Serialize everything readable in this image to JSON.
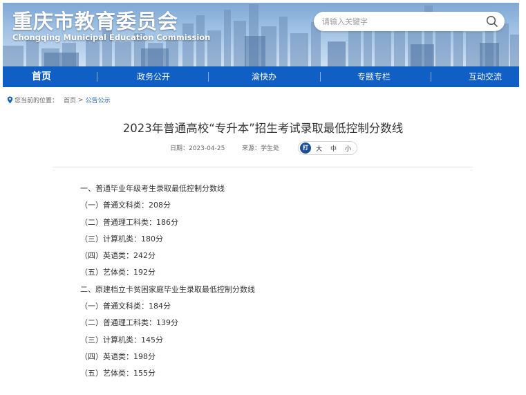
{
  "header": {
    "site_title": "重庆市教育委员会",
    "site_subtitle": "Chongqing Municipal Education Commission",
    "search_placeholder": "请输入关键字",
    "search_icon": "search-icon"
  },
  "nav": {
    "items": [
      {
        "label": "首页",
        "active": true
      },
      {
        "label": "政务公开"
      },
      {
        "label": "渝快办"
      },
      {
        "label": "专题专栏"
      },
      {
        "label": "互动交流"
      }
    ],
    "bg_color": "#0f5fc4"
  },
  "breadcrumb": {
    "prefix": "您当前的位置：",
    "home": "首页",
    "sep": ">",
    "current": "公告公示"
  },
  "article": {
    "title": "2023年普通高校“专升本”招生考试录取最低控制分数线",
    "date": "日期：2023-04-25",
    "source": "来源：学生处",
    "font_badge": "打",
    "font_sizes": [
      "大",
      "中",
      "小"
    ],
    "paragraphs": [
      "一、普通毕业年级考生录取最低控制分数线",
      "（一）普通文科类：208分",
      "（二）普通理工科类：186分",
      "（三）计算机类：180分",
      "（四）英语类：242分",
      "（五）艺体类：192分",
      "二、原建档立卡贫困家庭毕业生录取最低控制分数线",
      "（一）普通文科类：184分",
      "（二）普通理工科类：139分",
      "（三）计算机类：145分",
      "（四）英语类：198分",
      "（五）艺体类：155分"
    ]
  }
}
